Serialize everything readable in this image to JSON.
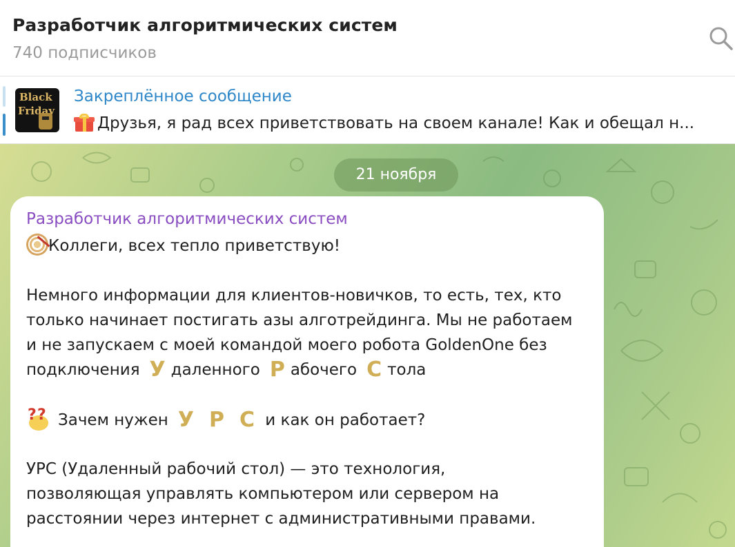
{
  "header": {
    "title": "Разработчик алгоритмических систем",
    "subscribers": "740 подписчиков",
    "search_icon": "search-icon"
  },
  "pinned": {
    "title": "Закреплённое сообщение",
    "thumbnail_text_1": "Black",
    "thumbnail_text_2": "Friday",
    "preview": "Друзья, я рад всех приветствовать на своем канале!  Как и обещал н..."
  },
  "chat": {
    "date_badge": "21 ноября",
    "message": {
      "author": "Разработчик алгоритмических систем",
      "greeting": "Коллеги, всех тепло приветствую!",
      "p1_l1": "Немного информации для клиентов-новичков, то есть, тех, кто",
      "p1_l2": "только начинает постигать азы алготрейдинга. Мы не работаем",
      "p1_l3": "и не запускаем с моей командой моего робота GoldenOne без",
      "p1_l4_a": "подключения",
      "glyph_u": "У",
      "p1_l4_b": "даленного",
      "glyph_r": "Р",
      "p1_l4_c": "абочего",
      "glyph_s": "С",
      "p1_l4_d": "тола",
      "q_a": "Зачем нужен",
      "q_b": "и как он работает?",
      "p2_l1": "УРС (Удаленный рабочий стол) — это технология,",
      "p2_l2": "позволяющая управлять компьютером или сервером на",
      "p2_l3": "расстоянии через интернет с административными правами."
    }
  },
  "colors": {
    "accent_blue": "#2e87c8",
    "author_purple": "#8a4dc1",
    "gold_letters": "#cfae56"
  }
}
